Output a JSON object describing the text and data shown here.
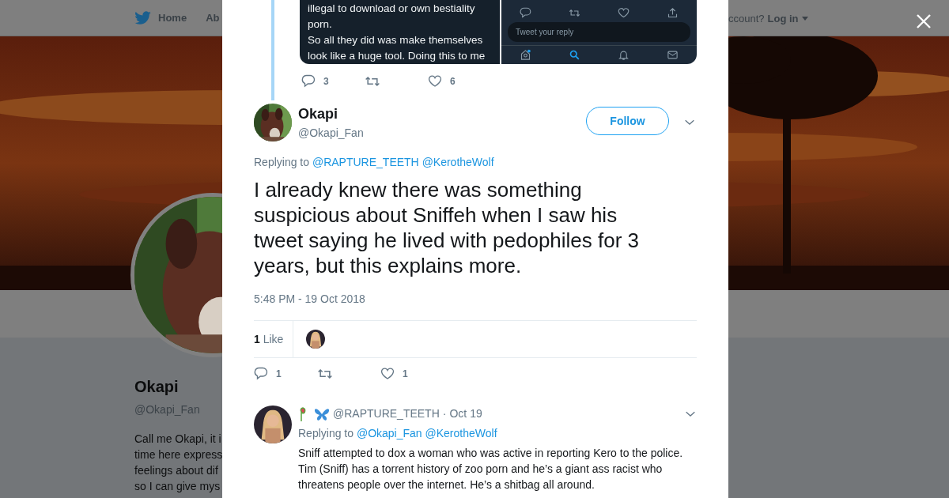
{
  "navbar": {
    "items": [
      {
        "label": "Home",
        "kind": "home"
      },
      {
        "label": "Ab",
        "kind": "plain"
      }
    ],
    "account_prompt": "ccount?",
    "login": "Log in"
  },
  "profile": {
    "name": "Okapi",
    "handle": "@Okapi_Fan",
    "bio_lines": [
      "Call me Okapi, it i",
      "time here express",
      "feelings about dif",
      "so I can give mys"
    ]
  },
  "modal": {
    "embedded_screenshot": {
      "lines": [
        "illegal to download or own bestiality",
        "porn.",
        "So all they did was make themselves",
        "look like a huge tool. Doing this to me"
      ],
      "reply_placeholder": "Tweet your reply"
    },
    "parent_actions": {
      "replies": "3",
      "likes": "6"
    },
    "tweet": {
      "name": "Okapi",
      "handle": "@Okapi_Fan",
      "follow": "Follow",
      "replying_label": "Replying to",
      "replying_to": [
        "@RAPTURE_TEETH",
        "@KerotheWolf"
      ],
      "text": "I already knew there was something suspicious about Sniffeh when I saw his tweet saying he lived with pedophiles for 3 years, but this explains more.",
      "timestamp": "5:48 PM - 19 Oct 2018",
      "like_count": "1",
      "like_label": "Like",
      "actions": {
        "replies": "1",
        "likes": "1"
      }
    },
    "replies": [
      {
        "handle": "@RAPTURE_TEETH",
        "separator": "·",
        "date": "Oct 19",
        "replying_label": "Replying to",
        "replying_to": [
          "@Okapi_Fan",
          "@KerotheWolf"
        ],
        "text": "Sniff attempted to dox a woman who was active in reporting Kero to the police. Tim (Sniff) has a torrent history of zoo porn and he’s a giant ass racist who threatens people over the internet. He’s a shitbag all around."
      }
    ]
  }
}
